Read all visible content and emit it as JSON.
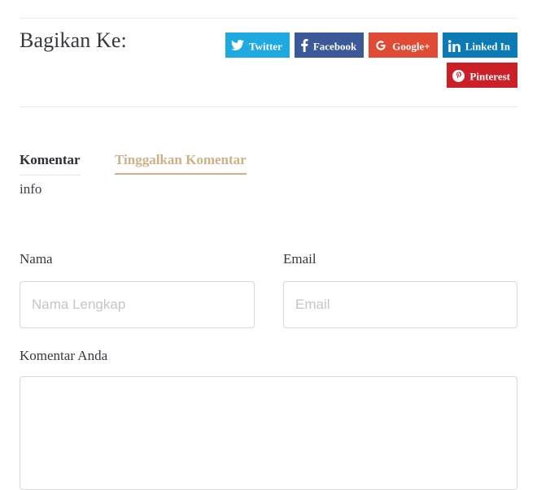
{
  "share": {
    "title": "Bagikan Ke:",
    "buttons": [
      {
        "label": "Twitter",
        "icon": "twitter-icon",
        "color": "#1eaae0"
      },
      {
        "label": "Facebook",
        "icon": "facebook-icon",
        "color": "#3b5998"
      },
      {
        "label": "Google+",
        "icon": "google-plus-icon",
        "color": "#e04b35"
      },
      {
        "label": "Linked In",
        "icon": "linkedin-icon",
        "color": "#0c7ab4"
      },
      {
        "label": "Pinterest",
        "icon": "pinterest-icon",
        "color": "#cb2027"
      }
    ]
  },
  "tabs": [
    {
      "label": "Komentar",
      "active": false
    },
    {
      "label": "Tinggalkan Komentar",
      "active": true
    }
  ],
  "info_text": "info",
  "form": {
    "name": {
      "label": "Nama",
      "placeholder": "Nama Lengkap",
      "value": ""
    },
    "email": {
      "label": "Email",
      "placeholder": "Email",
      "value": ""
    },
    "comment": {
      "label": "Komentar Anda",
      "placeholder": "",
      "value": ""
    }
  },
  "colors": {
    "accent_gold": "#cdb185",
    "divider": "#e8ebee",
    "input_border": "#d5d7d9",
    "placeholder": "#c3c6c9"
  }
}
